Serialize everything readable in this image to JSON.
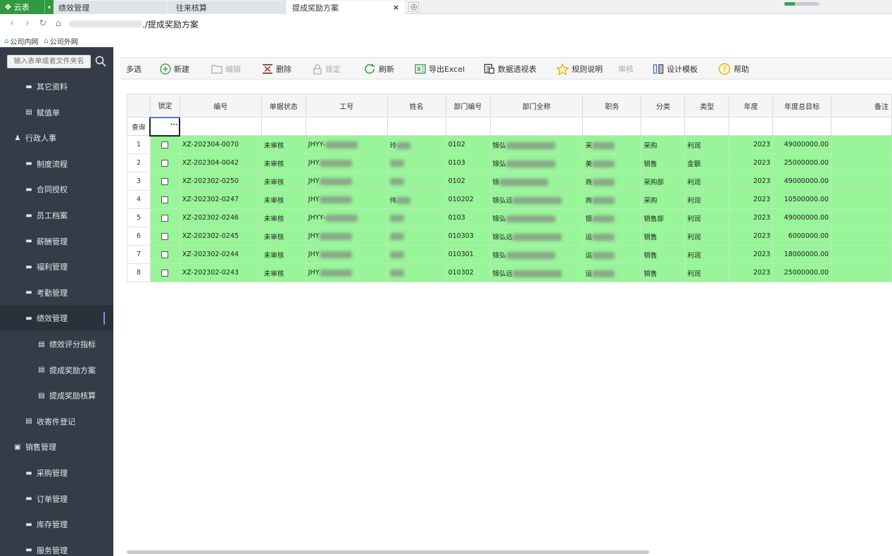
{
  "browser": {
    "app_label": "云表",
    "tabs": [
      {
        "label": "绩效管理"
      },
      {
        "label": "往来核算"
      },
      {
        "label": "提成奖励方案"
      }
    ],
    "tab_close": "×",
    "url_suffix": "./提成奖励方案",
    "bookmarks": [
      {
        "label": "公司内网"
      },
      {
        "label": "公司外网"
      }
    ],
    "progress_fraction": 0.3
  },
  "sidebar": {
    "search_placeholder": "输入表单或者文件夹名",
    "items": [
      {
        "label": "其它资料",
        "icon": "folder-icon",
        "level": 1
      },
      {
        "label": "赋值单",
        "icon": "document-icon",
        "level": 1
      },
      {
        "label": "行政人事",
        "icon": "user-group-icon",
        "level": 0
      },
      {
        "label": "制度流程",
        "icon": "folder-icon",
        "level": 1
      },
      {
        "label": "合同授权",
        "icon": "folder-icon",
        "level": 1
      },
      {
        "label": "员工档案",
        "icon": "folder-icon",
        "level": 1
      },
      {
        "label": "薪酬管理",
        "icon": "folder-icon",
        "level": 1
      },
      {
        "label": "福利管理",
        "icon": "folder-icon",
        "level": 1
      },
      {
        "label": "考勤管理",
        "icon": "folder-icon",
        "level": 1
      },
      {
        "label": "绩效管理",
        "icon": "folder-icon",
        "level": 1,
        "active": true
      },
      {
        "label": "绩效评分指标",
        "icon": "document-icon",
        "level": 2
      },
      {
        "label": "提成奖励方案",
        "icon": "document-icon",
        "level": 2
      },
      {
        "label": "提成奖励核算",
        "icon": "document-icon",
        "level": 2
      },
      {
        "label": "收寄件登记",
        "icon": "document-icon",
        "level": 1
      },
      {
        "label": "销售管理",
        "icon": "briefcase-icon",
        "level": 0
      },
      {
        "label": "采购管理",
        "icon": "folder-icon",
        "level": 1
      },
      {
        "label": "订单管理",
        "icon": "folder-icon",
        "level": 1
      },
      {
        "label": "库存管理",
        "icon": "folder-icon",
        "level": 1
      },
      {
        "label": "服务管理",
        "icon": "folder-icon",
        "level": 1
      }
    ]
  },
  "toolbar": {
    "multi_select": "多选",
    "new": "新建",
    "edit": "编辑",
    "delete": "删除",
    "lock": "锁定",
    "refresh": "刷新",
    "export": "导出Excel",
    "pivot": "数据透视表",
    "rules": "规则说明",
    "review": "审核",
    "design": "设计模板",
    "help": "帮助"
  },
  "grid": {
    "query_label": "查询",
    "query_dots": "···",
    "columns": [
      "锁定",
      "编号",
      "单据状态",
      "工号",
      "姓名",
      "部门编号",
      "部门全称",
      "职务",
      "分类",
      "类型",
      "年度",
      "年度总目标",
      "备注"
    ],
    "rows": [
      {
        "n": "1",
        "code": "XZ-202304-0070",
        "status": "未审核",
        "empno": "JHYY-",
        "name": "玲",
        "dept": "0102",
        "deptname": "锦弘",
        "title": "采",
        "cls": "采购",
        "type": "利润",
        "year": "2023",
        "target": "49000000.00"
      },
      {
        "n": "2",
        "code": "XZ-202304-0042",
        "status": "未审核",
        "empno": "JHY",
        "name": "",
        "dept": "0103",
        "deptname": "锦弘",
        "title": "美",
        "cls": "销售",
        "type": "金额",
        "year": "2023",
        "target": "25000000.00"
      },
      {
        "n": "3",
        "code": "XZ-202302-0250",
        "status": "未审核",
        "empno": "JHY",
        "name": "",
        "dept": "0102",
        "deptname": "锦",
        "title": "商",
        "cls": "采购部",
        "type": "利润",
        "year": "2023",
        "target": "49000000.00"
      },
      {
        "n": "4",
        "code": "XZ-202302-0247",
        "status": "未审核",
        "empno": "JHY",
        "name": "伟",
        "dept": "010202",
        "deptname": "锦弘远",
        "title": "商",
        "cls": "采购",
        "type": "利润",
        "year": "2023",
        "target": "10500000.00"
      },
      {
        "n": "5",
        "code": "XZ-202302-0246",
        "status": "未审核",
        "empno": "JHYY-",
        "name": "",
        "dept": "0103",
        "deptname": "锦弘",
        "title": "银",
        "cls": "销售部",
        "type": "利润",
        "year": "2023",
        "target": "49000000.00"
      },
      {
        "n": "6",
        "code": "XZ-202302-0245",
        "status": "未审核",
        "empno": "JHY",
        "name": "",
        "dept": "010303",
        "deptname": "锦弘远",
        "title": "运",
        "cls": "销售",
        "type": "利润",
        "year": "2023",
        "target": "6000000.00"
      },
      {
        "n": "7",
        "code": "XZ-202302-0244",
        "status": "未审核",
        "empno": "JHY",
        "name": "",
        "dept": "010301",
        "deptname": "锦弘",
        "title": "运",
        "cls": "销售",
        "type": "利润",
        "year": "2023",
        "target": "18000000.00"
      },
      {
        "n": "8",
        "code": "XZ-202302-0243",
        "status": "未审核",
        "empno": "JHY",
        "name": "",
        "dept": "010302",
        "deptname": "锦弘远",
        "title": "运",
        "cls": "销售",
        "type": "利润",
        "year": "2023",
        "target": "25000000.00"
      }
    ]
  },
  "colors": {
    "accent_green": "#2f9a3e",
    "row_green": "#98f598",
    "sidebar_bg": "#353c48"
  }
}
